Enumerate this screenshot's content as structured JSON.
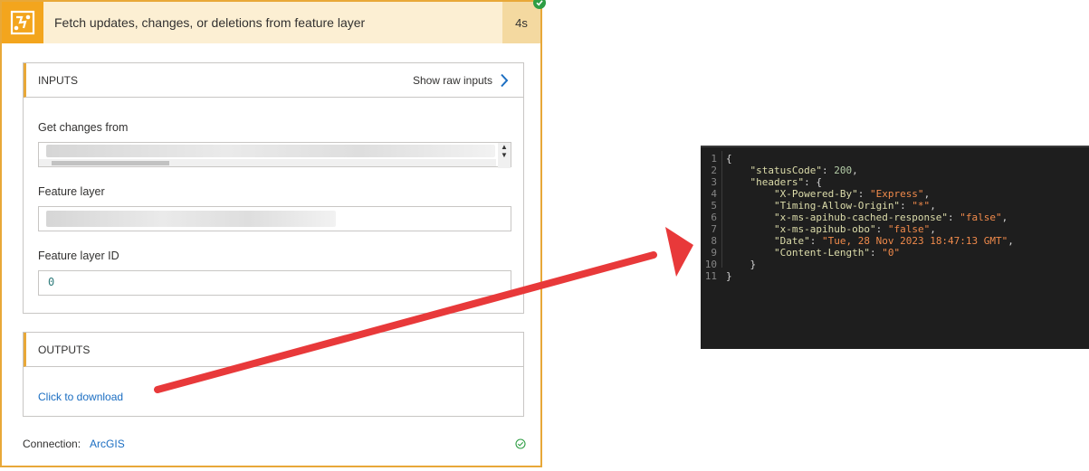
{
  "action": {
    "title": "Fetch updates, changes, or deletions from feature layer",
    "duration": "4s"
  },
  "inputs": {
    "heading": "INPUTS",
    "show_raw": "Show raw inputs",
    "fields": [
      {
        "label": "Get changes from",
        "value": ""
      },
      {
        "label": "Feature layer",
        "value": ""
      },
      {
        "label": "Feature layer ID",
        "value": "0"
      }
    ]
  },
  "outputs": {
    "heading": "OUTPUTS",
    "download": "Click to download"
  },
  "connection": {
    "label": "Connection:",
    "name": "ArcGIS"
  },
  "code": {
    "line_numbers": [
      "1",
      "2",
      "3",
      "4",
      "5",
      "6",
      "7",
      "8",
      "9",
      "10",
      "11"
    ],
    "lines": [
      "{",
      "    \"statusCode\": 200,",
      "    \"headers\": {",
      "        \"X-Powered-By\": \"Express\",",
      "        \"Timing-Allow-Origin\": \"*\",",
      "        \"x-ms-apihub-cached-response\": \"false\",",
      "        \"x-ms-apihub-obo\": \"false\",",
      "        \"Date\": \"Tue, 28 Nov 2023 18:47:13 GMT\",",
      "        \"Content-Length\": \"0\"",
      "    }",
      "}"
    ]
  },
  "colors": {
    "accent": "#e8a838",
    "link": "#1b6ec2",
    "success": "#2e9e44",
    "arrow": "#e8393a"
  }
}
